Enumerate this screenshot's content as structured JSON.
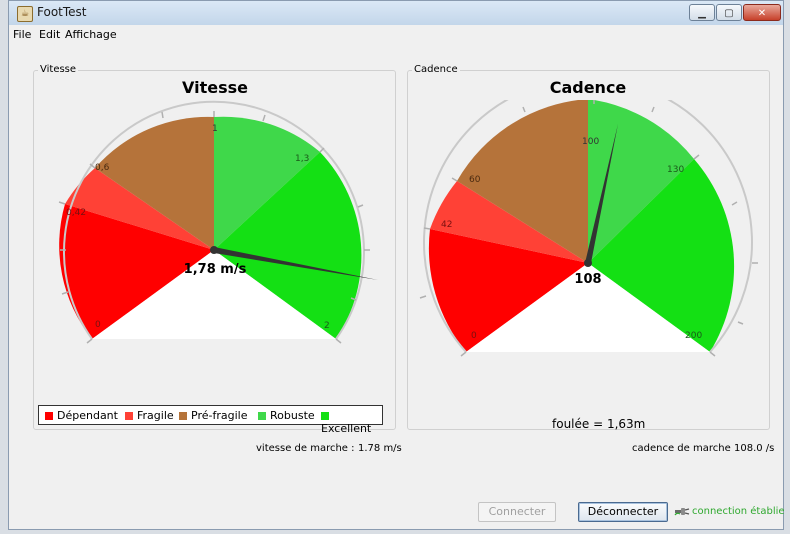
{
  "window": {
    "title": "FootTest",
    "app_icon": "java-cup-icon"
  },
  "menu": [
    "File",
    "Edit",
    "Affichage"
  ],
  "vitesse": {
    "panel_label": "Vitesse",
    "title": "Vitesse",
    "value_label": "1,78 m/s",
    "value": 1.78,
    "scale_min": 0,
    "scale_max": 2,
    "tick_labels": [
      "0",
      "0,42",
      "0,6",
      "1",
      "1,3",
      "2"
    ],
    "segments": [
      {
        "name": "Dépendant",
        "color": "#ff0000"
      },
      {
        "name": "Fragile",
        "color": "#ff4136"
      },
      {
        "name": "Pré-fragile",
        "color": "#b5733a"
      },
      {
        "name": "Robuste",
        "color": "#3fd84a"
      },
      {
        "name": "Excellent",
        "color": "#14e014"
      }
    ],
    "status_label": "vitesse de marche :",
    "status_value": "1.78 m/s"
  },
  "cadence": {
    "panel_label": "Cadence",
    "title": "Cadence",
    "value_label": "108",
    "value": 108,
    "tick_labels": [
      "0",
      "42",
      "60",
      "100",
      "130",
      "200"
    ],
    "foulee": "foulée = 1,63m",
    "status_label": "cadence de marche",
    "status_value": "108.0 /s"
  },
  "legend": [
    {
      "label": "Dépendant",
      "color": "#ff0000"
    },
    {
      "label": "Fragile",
      "color": "#ff4136"
    },
    {
      "label": "Pré-fragile",
      "color": "#b5733a"
    },
    {
      "label": "Robuste",
      "color": "#3fd84a"
    },
    {
      "label": "Excellent",
      "color": "#14e014"
    }
  ],
  "buttons": {
    "connect": "Connecter",
    "disconnect": "Déconnecter"
  },
  "connection": {
    "icon": "plug-icon",
    "text": "connection établie"
  }
}
